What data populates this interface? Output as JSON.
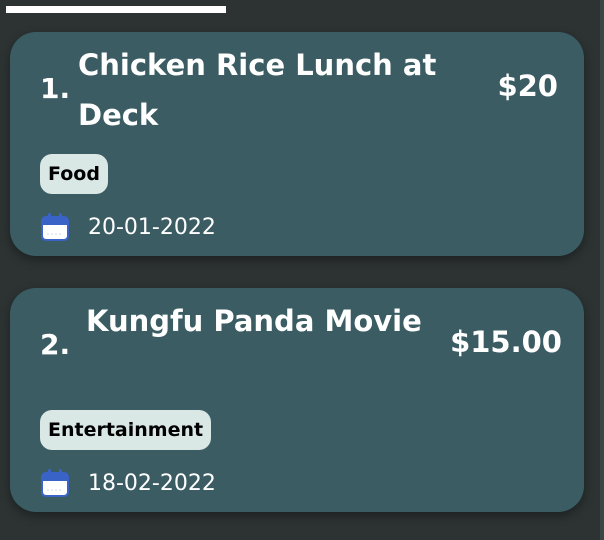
{
  "expenses": [
    {
      "index": "1.",
      "title": "Chicken Rice Lunch at Deck",
      "amount": "$20",
      "category": "Food",
      "date": "20-01-2022"
    },
    {
      "index": "2.",
      "title": "Kungfu Panda Movie",
      "amount": "$15.00",
      "category": "Entertainment",
      "date": "18-02-2022"
    }
  ],
  "icons": {
    "date": "calendar-icon"
  },
  "colors": {
    "background": "#2c3332",
    "card": "#3b5c63",
    "tag": "#d9e8e4",
    "calendar_accent": "#3a63c8"
  }
}
